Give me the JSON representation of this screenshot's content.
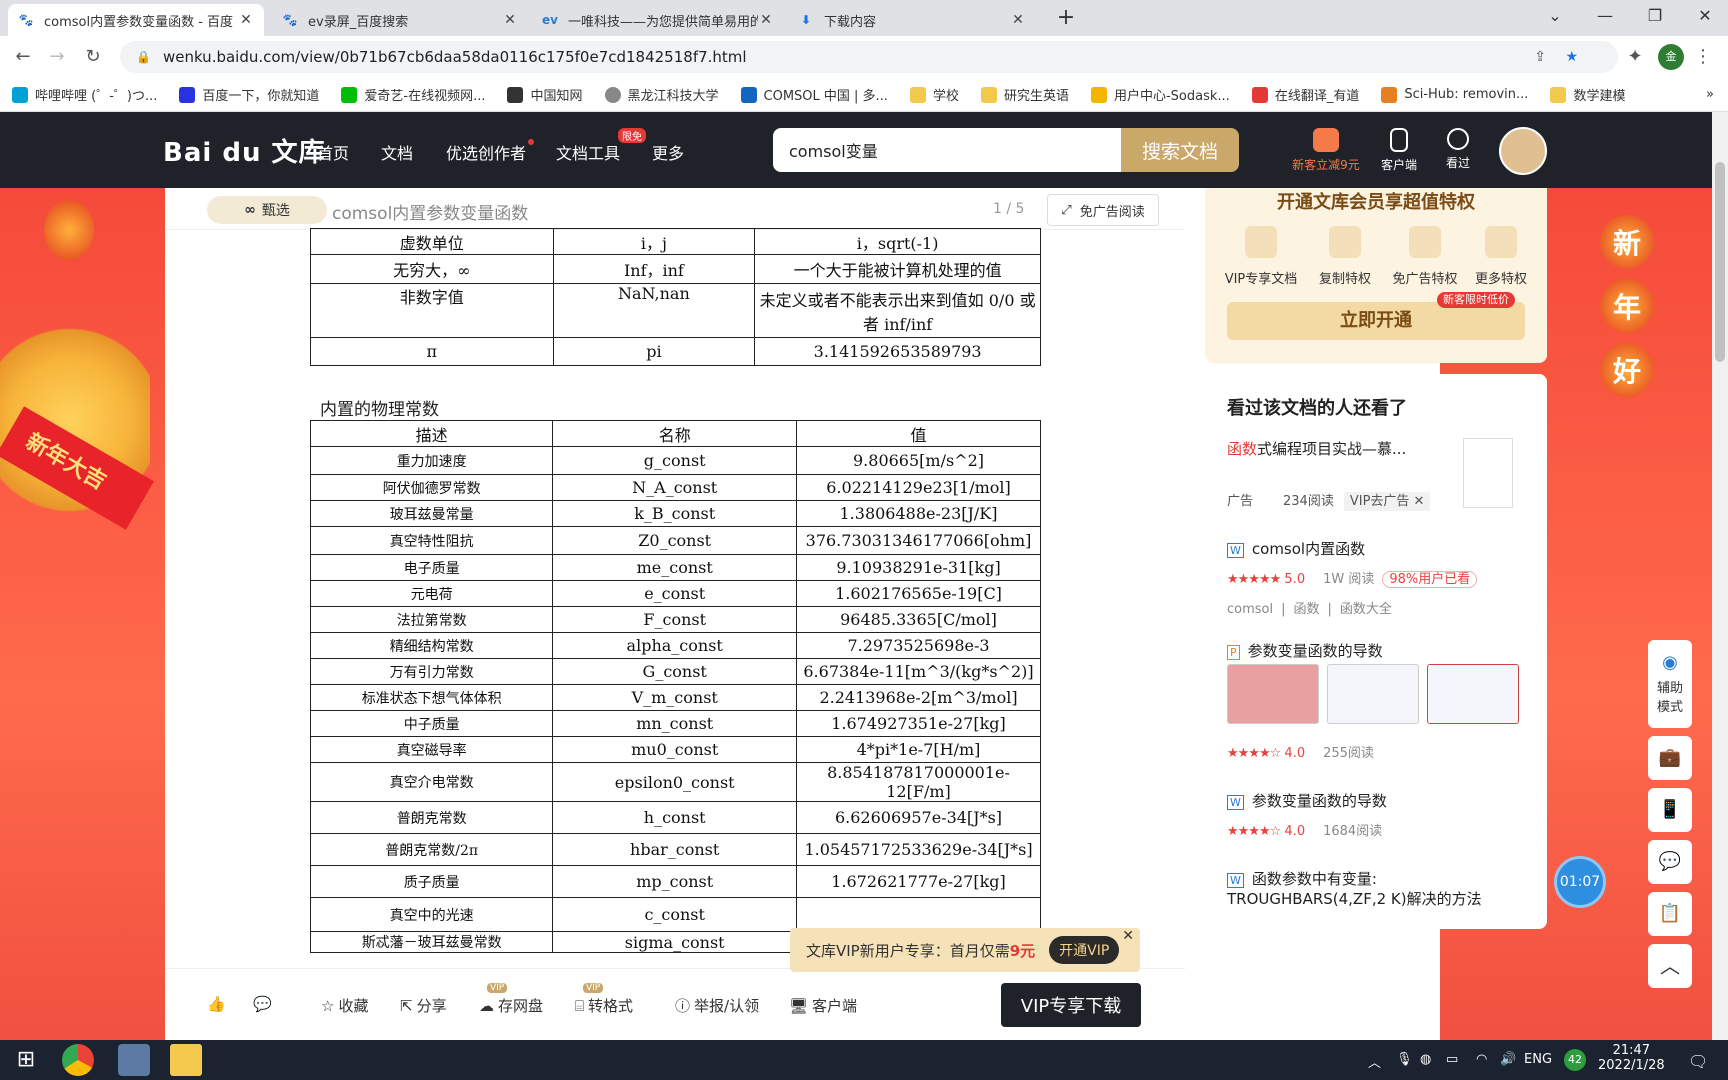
{
  "browser": {
    "tabs": [
      {
        "title": "comsol内置参数变量函数 - 百度",
        "active": true
      },
      {
        "title": "ev录屏_百度搜索",
        "active": false
      },
      {
        "title": "一唯科技——为您提供简单易用的",
        "active": false
      },
      {
        "title": "下载内容",
        "active": false
      }
    ],
    "url": "wenku.baidu.com/view/0b71b67cb6daa58da0116c175f0e7cd1842518f7.html",
    "bookmarks": [
      "哔哩哔哩 (゜-゜)つ...",
      "百度一下，你就知道",
      "爱奇艺-在线视频网...",
      "中国知网",
      "黑龙江科技大学",
      "COMSOL 中国 | 多...",
      "学校",
      "研究生英语",
      "用户中心-Sodask...",
      "在线翻译_有道",
      "Sci-Hub: removin...",
      "数学建模"
    ],
    "more_bookmarks": "»"
  },
  "header": {
    "logo": "Bai du 文库",
    "nav": [
      "首页",
      "文档",
      "优选创作者",
      "文档工具",
      "更多"
    ],
    "tool_badge": "限免",
    "search_value": "comsol变量",
    "search_button": "搜索文档",
    "vip_label": "新客立减9元",
    "client_label": "客户端",
    "history_label": "看过"
  },
  "doc": {
    "pill": "甄选",
    "title": "comsol内置参数变量函数",
    "page": "1 / 5",
    "adfree": "免广告阅读",
    "table1": [
      [
        "虚数单位",
        "i，j",
        "i，sqrt(-1)"
      ],
      [
        "无穷大，∞",
        "Inf，inf",
        "一个大于能被计算机处理的值"
      ],
      [
        "非数字值",
        "NaN,nan",
        "未定义或者不能表示出来到值如 0/0 或者 inf/inf"
      ],
      [
        "π",
        "pi",
        "3.141592653589793"
      ]
    ],
    "section_title": "内置的物理常数",
    "table2_headers": [
      "描述",
      "名称",
      "值"
    ],
    "table2": [
      [
        "重力加速度",
        "g_const",
        "9.80665[m/s^2]"
      ],
      [
        "阿伏伽德罗常数",
        "N_A_const",
        "6.02214129e23[1/mol]"
      ],
      [
        "玻耳兹曼常量",
        "k_B_const",
        "1.3806488e-23[J/K]"
      ],
      [
        "真空特性阻抗",
        "Z0_const",
        "376.73031346177066[ohm]"
      ],
      [
        "电子质量",
        "me_const",
        "9.10938291e-31[kg]"
      ],
      [
        "元电荷",
        "e_const",
        "1.602176565e-19[C]"
      ],
      [
        "法拉第常数",
        "F_const",
        "96485.3365[C/mol]"
      ],
      [
        "精细结构常数",
        "alpha_const",
        "7.2973525698e-3"
      ],
      [
        "万有引力常数",
        "G_const",
        "6.67384e-11[m^3/(kg*s^2)]"
      ],
      [
        "标准状态下想气体体积",
        "V_m_const",
        "2.2413968e-2[m^3/mol]"
      ],
      [
        "中子质量",
        "mn_const",
        "1.674927351e-27[kg]"
      ],
      [
        "真空磁导率",
        "mu0_const",
        "4*pi*1e-7[H/m]"
      ],
      [
        "真空介电常数",
        "epsilon0_const",
        "8.854187817000001e-12[F/m]"
      ],
      [
        "普朗克常数",
        "h_const",
        "6.62606957e-34[J*s]"
      ],
      [
        "普朗克常数/2π",
        "hbar_const",
        "1.05457172533629e-34[J*s]"
      ],
      [
        "质子质量",
        "mp_const",
        "1.672621777e-27[kg]"
      ],
      [
        "真空中的光速",
        "c_const",
        ""
      ],
      [
        "斯忒藩－玻耳兹曼常数",
        "sigma_const",
        ""
      ]
    ]
  },
  "toolbar": {
    "items": [
      "收藏",
      "分享",
      "存网盘",
      "转格式",
      "举报/认领",
      "客户端"
    ],
    "vip_badge": "VIP",
    "download": "VIP专享下载",
    "promo_text": "文库VIP新用户专享：首月仅需",
    "promo_price": "9元",
    "promo_button": "开通VIP"
  },
  "right": {
    "vip_head": "开通文库会员享超值特权",
    "perks": [
      "VIP专享文档",
      "复制特权",
      "免广告特权",
      "更多特权"
    ],
    "open_button": "立即开通",
    "open_tag": "新客限时低价",
    "related_head": "看过该文档的人还看了",
    "ad_title_hl": "函数",
    "ad_title": "式编程项目实战—慕...",
    "ad_label": "广告",
    "ad_reads": "234阅读",
    "ad_vip": "VIP去广告",
    "items": [
      {
        "title": "comsol内置函数",
        "rating": "5.0",
        "reads": "1W 阅读",
        "badge": "98%用户已看",
        "tags": [
          "comsol",
          "函数",
          "函数大全"
        ]
      },
      {
        "title": "参数变量函数的导数",
        "rating": "4.0",
        "reads": "255阅读"
      },
      {
        "title": "参数变量函数的导数",
        "rating": "4.0",
        "reads": "1684阅读"
      },
      {
        "title": "函数参数中有变量: TROUGHBARS(4,ZF,2 K)解决的方法"
      }
    ]
  },
  "side": {
    "assist": "辅助模式",
    "timer": "01:07"
  },
  "decor": {
    "greeting": [
      "新",
      "年",
      "好"
    ],
    "lion_banner": "新年大吉"
  },
  "taskbar": {
    "lang": "ENG",
    "time": "21:47",
    "date": "2022/1/28",
    "badge": "42"
  }
}
